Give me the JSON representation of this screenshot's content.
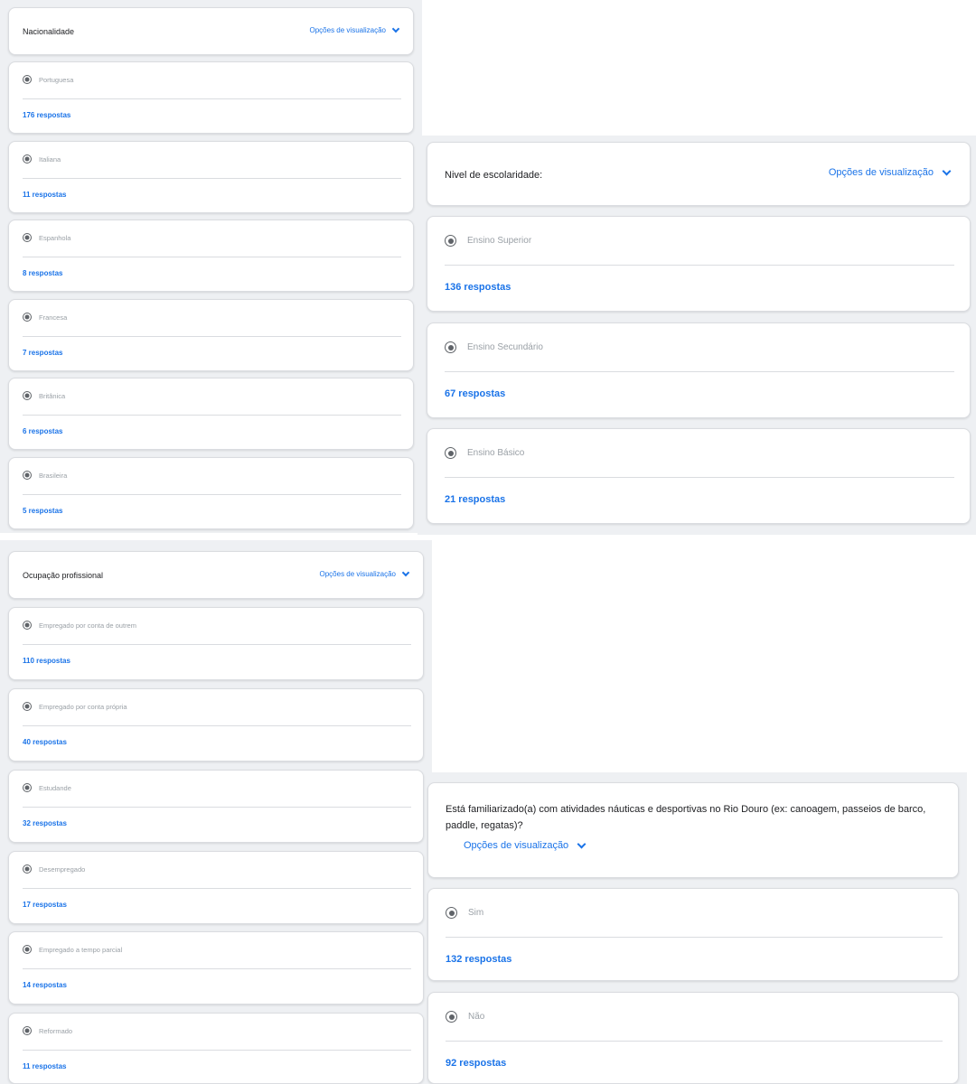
{
  "view_options_label": "Opções de visualização",
  "sections": {
    "nacionalidade": {
      "title": "Nacionalidade",
      "options": [
        {
          "label": "Portuguesa",
          "responses": "176 respostas"
        },
        {
          "label": "Italiana",
          "responses": "11 respostas"
        },
        {
          "label": "Espanhola",
          "responses": "8 respostas"
        },
        {
          "label": "Francesa",
          "responses": "7 respostas"
        },
        {
          "label": "Britânica",
          "responses": "6 respostas"
        },
        {
          "label": "Brasileira",
          "responses": "5 respostas"
        }
      ]
    },
    "escolaridade": {
      "title": "Nivel de escolaridade:",
      "options": [
        {
          "label": "Ensino Superior",
          "responses": "136 respostas"
        },
        {
          "label": "Ensino Secundário",
          "responses": "67 respostas"
        },
        {
          "label": "Ensino Básico",
          "responses": "21 respostas"
        }
      ]
    },
    "ocupacao": {
      "title": "Ocupação profissional",
      "options": [
        {
          "label": "Empregado por conta de outrem",
          "responses": "110 respostas"
        },
        {
          "label": "Empregado por conta própria",
          "responses": "40 respostas"
        },
        {
          "label": "Estudande",
          "responses": "32 respostas"
        },
        {
          "label": "Desempregado",
          "responses": "17 respostas"
        },
        {
          "label": "Empregado a tempo parcial",
          "responses": "14 respostas"
        },
        {
          "label": "Reformado",
          "responses": "11 respostas"
        }
      ]
    },
    "nauticas": {
      "title": "Está familiarizado(a) com atividades náuticas e desportivas no Rio Douro (ex: canoagem, passeios de barco, paddle, regatas)?",
      "options": [
        {
          "label": "Sim",
          "responses": "132 respostas"
        },
        {
          "label": "Não",
          "responses": "92 respostas"
        }
      ]
    }
  }
}
